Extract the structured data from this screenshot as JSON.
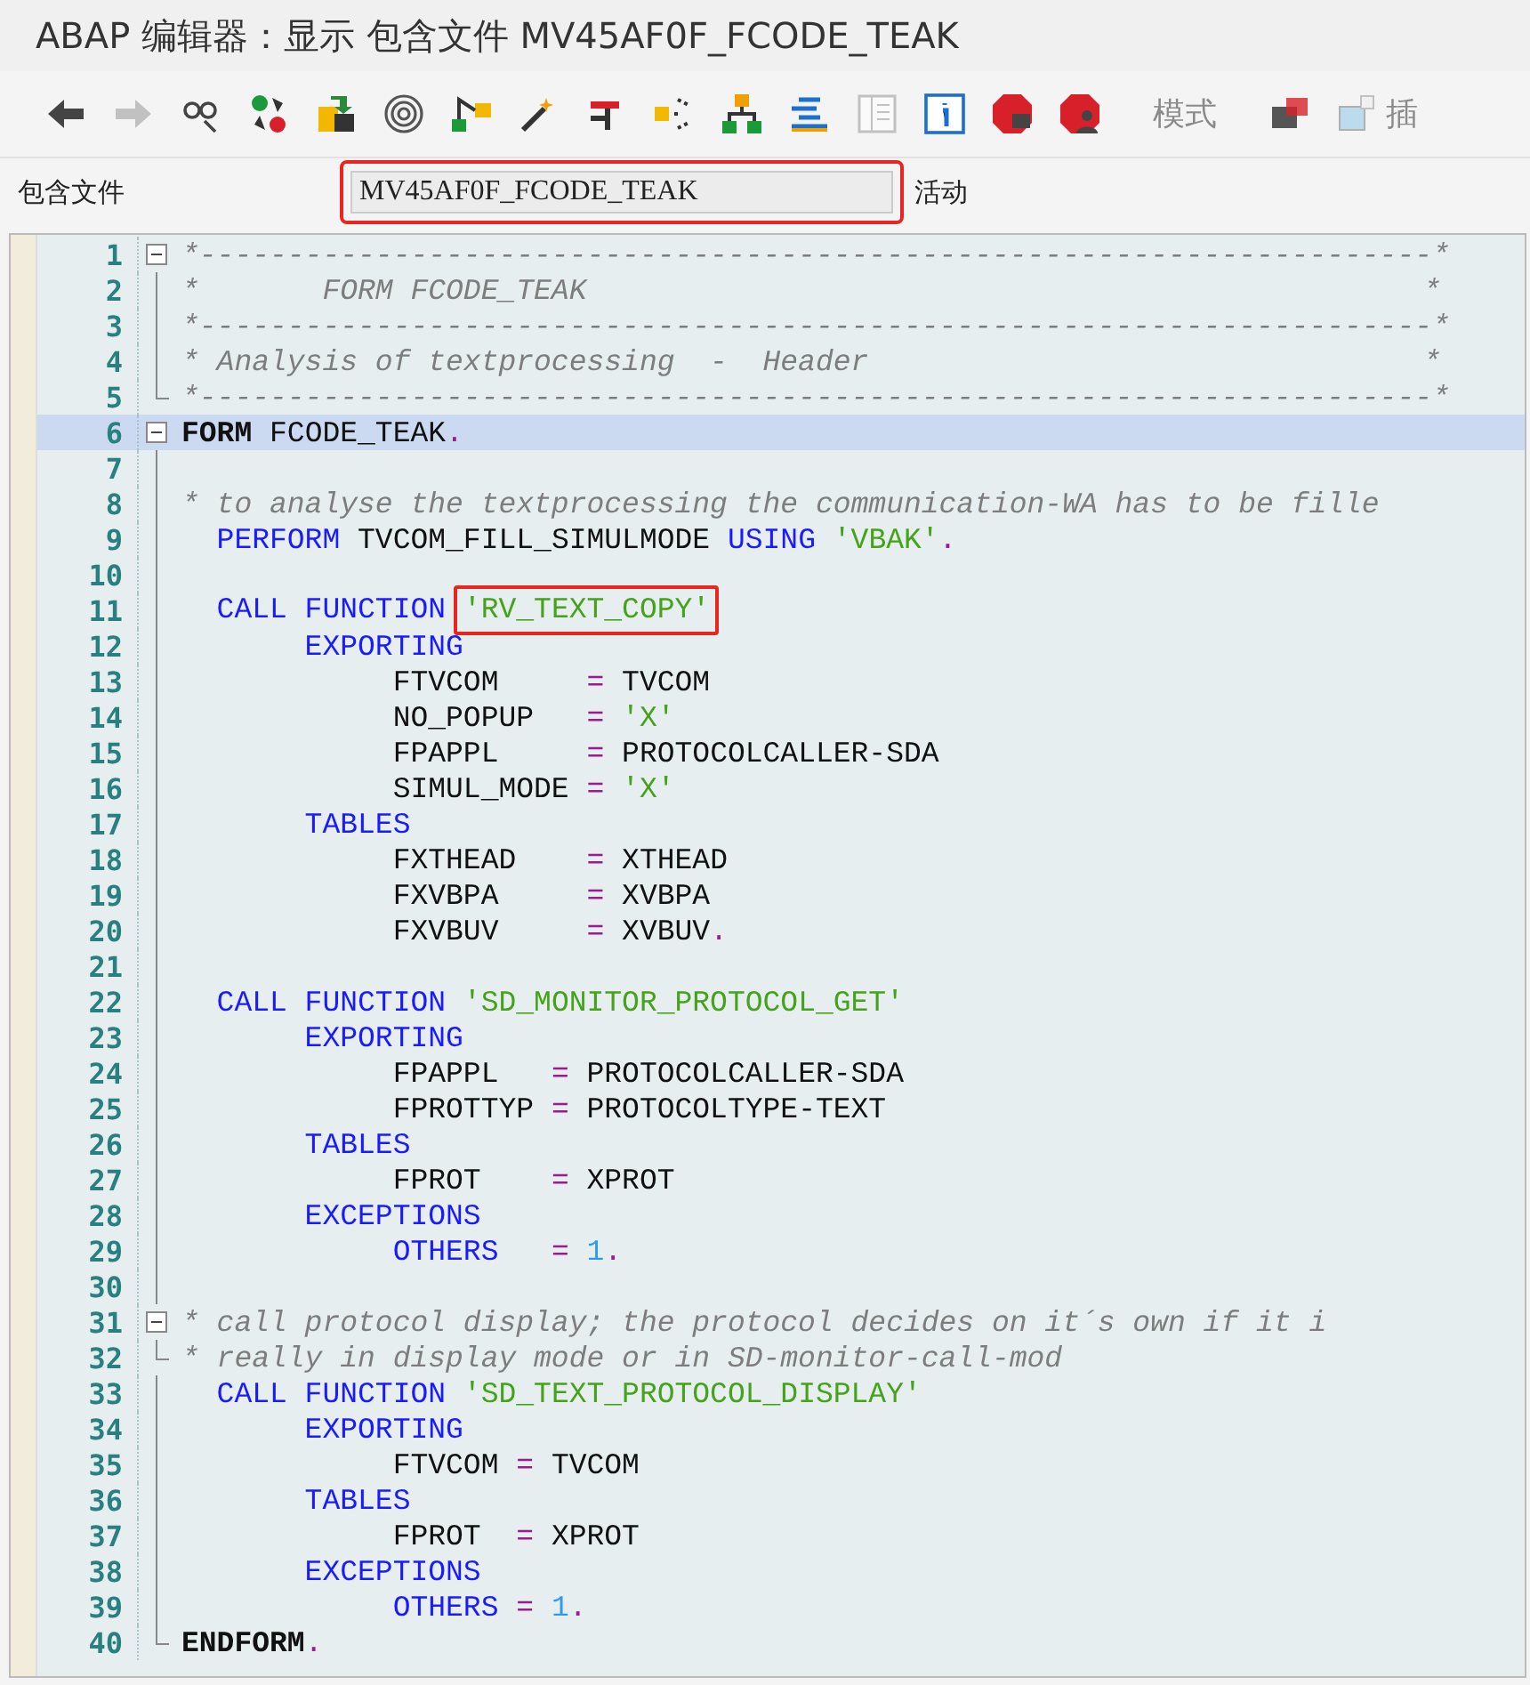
{
  "window": {
    "title": "ABAP 编辑器：显示 包含文件 MV45AF0F_FCODE_TEAK"
  },
  "toolbar": [
    {
      "kind": "back",
      "disabled": false
    },
    {
      "kind": "forward",
      "disabled": true
    },
    {
      "kind": "glasses",
      "disabled": false
    },
    {
      "kind": "cycle",
      "disabled": false
    },
    {
      "kind": "transport",
      "disabled": false
    },
    {
      "kind": "spiral",
      "disabled": false
    },
    {
      "kind": "hierarchy",
      "disabled": false
    },
    {
      "kind": "wand",
      "disabled": false
    },
    {
      "kind": "stamp",
      "disabled": false
    },
    {
      "kind": "branch",
      "disabled": false
    },
    {
      "kind": "tree",
      "disabled": false
    },
    {
      "kind": "lines",
      "disabled": false
    },
    {
      "kind": "page",
      "disabled": true
    },
    {
      "kind": "info",
      "disabled": false
    },
    {
      "kind": "stop",
      "disabled": false
    },
    {
      "kind": "stop-user",
      "disabled": false
    },
    {
      "kind": "text",
      "label": "模式",
      "disabled": true
    },
    {
      "kind": "blocks",
      "disabled": false
    },
    {
      "kind": "insert",
      "label": "插",
      "disabled": true
    }
  ],
  "include_field": {
    "label": "包含文件",
    "value": "MV45AF0F_FCODE_TEAK",
    "highlighted": true,
    "status": "活动"
  },
  "editor": {
    "lines": [
      {
        "number": "1",
        "current": false,
        "kind": "open",
        "end_mark": "*",
        "tokens": [
          {
            "kind": "cmt",
            "t": "*----------------------------------------------------------------------"
          }
        ]
      },
      {
        "number": "2",
        "current": false,
        "kind": "line",
        "end_mark": "*",
        "tokens": [
          {
            "kind": "cmt",
            "t": "*       FORM FCODE_TEAK"
          }
        ]
      },
      {
        "number": "3",
        "current": false,
        "kind": "line",
        "end_mark": "*",
        "tokens": [
          {
            "kind": "cmt",
            "t": "*----------------------------------------------------------------------"
          }
        ]
      },
      {
        "number": "4",
        "current": false,
        "kind": "line",
        "end_mark": "*",
        "tokens": [
          {
            "kind": "cmt",
            "t": "* Analysis of textprocessing  -  Header"
          }
        ]
      },
      {
        "number": "5",
        "current": false,
        "kind": "end",
        "end_mark": "*",
        "tokens": [
          {
            "kind": "cmt",
            "t": "*----------------------------------------------------------------------"
          }
        ]
      },
      {
        "number": "6",
        "current": true,
        "kind": "open",
        "tokens": [
          {
            "kind": "bold",
            "t": "FORM"
          },
          {
            "kind": "id",
            "t": " FCODE_TEAK"
          },
          {
            "kind": "op",
            "t": "."
          }
        ]
      },
      {
        "number": "7",
        "current": false,
        "kind": "line"
      },
      {
        "number": "8",
        "current": false,
        "kind": "line",
        "tokens": [
          {
            "kind": "cmt",
            "t": "* to analyse the textprocessing the communication-WA has to be fille"
          }
        ]
      },
      {
        "number": "9",
        "current": false,
        "kind": "line",
        "tokens": [
          {
            "kind": "kw",
            "t": "  PERFORM"
          },
          {
            "kind": "id",
            "t": " TVCOM_FILL_SIMULMODE "
          },
          {
            "kind": "kw",
            "t": "USING"
          },
          {
            "kind": "str",
            "t": " 'VBAK'"
          },
          {
            "kind": "op",
            "t": "."
          }
        ]
      },
      {
        "number": "10",
        "current": false,
        "kind": "line"
      },
      {
        "number": "11",
        "current": false,
        "kind": "line",
        "tokens": [
          {
            "kind": "kw",
            "t": "  CALL FUNCTION "
          },
          {
            "kind": "str",
            "t": "'RV_TEXT_COPY'",
            "highlighted": true
          }
        ]
      },
      {
        "number": "12",
        "current": false,
        "kind": "line",
        "tokens": [
          {
            "kind": "kw",
            "t": "       EXPORTING"
          }
        ]
      },
      {
        "number": "13",
        "current": false,
        "kind": "line",
        "tokens": [
          {
            "kind": "id",
            "t": "            FTVCOM     "
          },
          {
            "kind": "op",
            "t": "="
          },
          {
            "kind": "id",
            "t": " TVCOM"
          }
        ]
      },
      {
        "number": "14",
        "current": false,
        "kind": "line",
        "tokens": [
          {
            "kind": "id",
            "t": "            NO_POPUP   "
          },
          {
            "kind": "op",
            "t": "="
          },
          {
            "kind": "str",
            "t": " 'X'"
          }
        ]
      },
      {
        "number": "15",
        "current": false,
        "kind": "line",
        "tokens": [
          {
            "kind": "id",
            "t": "            FPAPPL     "
          },
          {
            "kind": "op",
            "t": "="
          },
          {
            "kind": "id",
            "t": " PROTOCOLCALLER-SDA"
          }
        ]
      },
      {
        "number": "16",
        "current": false,
        "kind": "line",
        "tokens": [
          {
            "kind": "id",
            "t": "            SIMUL_MODE "
          },
          {
            "kind": "op",
            "t": "="
          },
          {
            "kind": "str",
            "t": " 'X'"
          }
        ]
      },
      {
        "number": "17",
        "current": false,
        "kind": "line",
        "tokens": [
          {
            "kind": "kw",
            "t": "       TABLES"
          }
        ]
      },
      {
        "number": "18",
        "current": false,
        "kind": "line",
        "tokens": [
          {
            "kind": "id",
            "t": "            FXTHEAD    "
          },
          {
            "kind": "op",
            "t": "="
          },
          {
            "kind": "id",
            "t": " XTHEAD"
          }
        ]
      },
      {
        "number": "19",
        "current": false,
        "kind": "line",
        "tokens": [
          {
            "kind": "id",
            "t": "            FXVBPA     "
          },
          {
            "kind": "op",
            "t": "="
          },
          {
            "kind": "id",
            "t": " XVBPA"
          }
        ]
      },
      {
        "number": "20",
        "current": false,
        "kind": "line",
        "tokens": [
          {
            "kind": "id",
            "t": "            FXVBUV     "
          },
          {
            "kind": "op",
            "t": "="
          },
          {
            "kind": "id",
            "t": " XVBUV"
          },
          {
            "kind": "op",
            "t": "."
          }
        ]
      },
      {
        "number": "21",
        "current": false,
        "kind": "line"
      },
      {
        "number": "22",
        "current": false,
        "kind": "line",
        "tokens": [
          {
            "kind": "kw",
            "t": "  CALL FUNCTION "
          },
          {
            "kind": "str",
            "t": "'SD_MONITOR_PROTOCOL_GET'"
          }
        ]
      },
      {
        "number": "23",
        "current": false,
        "kind": "line",
        "tokens": [
          {
            "kind": "kw",
            "t": "       EXPORTING"
          }
        ]
      },
      {
        "number": "24",
        "current": false,
        "kind": "line",
        "tokens": [
          {
            "kind": "id",
            "t": "            FPAPPL   "
          },
          {
            "kind": "op",
            "t": "="
          },
          {
            "kind": "id",
            "t": " PROTOCOLCALLER-SDA"
          }
        ]
      },
      {
        "number": "25",
        "current": false,
        "kind": "line",
        "tokens": [
          {
            "kind": "id",
            "t": "            FPROTTYP "
          },
          {
            "kind": "op",
            "t": "="
          },
          {
            "kind": "id",
            "t": " PROTOCOLTYPE-TEXT"
          }
        ]
      },
      {
        "number": "26",
        "current": false,
        "kind": "line",
        "tokens": [
          {
            "kind": "kw",
            "t": "       TABLES"
          }
        ]
      },
      {
        "number": "27",
        "current": false,
        "kind": "line",
        "tokens": [
          {
            "kind": "id",
            "t": "            FPROT    "
          },
          {
            "kind": "op",
            "t": "="
          },
          {
            "kind": "id",
            "t": " XPROT"
          }
        ]
      },
      {
        "number": "28",
        "current": false,
        "kind": "line",
        "tokens": [
          {
            "kind": "kw",
            "t": "       EXCEPTIONS"
          }
        ]
      },
      {
        "number": "29",
        "current": false,
        "kind": "line",
        "tokens": [
          {
            "kind": "kw",
            "t": "            OTHERS   "
          },
          {
            "kind": "op",
            "t": "="
          },
          {
            "kind": "num",
            "t": " 1"
          },
          {
            "kind": "op",
            "t": "."
          }
        ]
      },
      {
        "number": "30",
        "current": false,
        "kind": "line"
      },
      {
        "number": "31",
        "current": false,
        "kind": "open",
        "tokens": [
          {
            "kind": "cmt",
            "t": "* call protocol display; the protocol decides on it´s own if it i"
          }
        ]
      },
      {
        "number": "32",
        "current": false,
        "kind": "end",
        "tokens": [
          {
            "kind": "cmt",
            "t": "* really in display mode or in SD-monitor-call-mod"
          }
        ]
      },
      {
        "number": "33",
        "current": false,
        "kind": "line",
        "tokens": [
          {
            "kind": "kw",
            "t": "  CALL FUNCTION "
          },
          {
            "kind": "str",
            "t": "'SD_TEXT_PROTOCOL_DISPLAY'"
          }
        ]
      },
      {
        "number": "34",
        "current": false,
        "kind": "line",
        "tokens": [
          {
            "kind": "kw",
            "t": "       EXPORTING"
          }
        ]
      },
      {
        "number": "35",
        "current": false,
        "kind": "line",
        "tokens": [
          {
            "kind": "id",
            "t": "            FTVCOM "
          },
          {
            "kind": "op",
            "t": "="
          },
          {
            "kind": "id",
            "t": " TVCOM"
          }
        ]
      },
      {
        "number": "36",
        "current": false,
        "kind": "line",
        "tokens": [
          {
            "kind": "kw",
            "t": "       TABLES"
          }
        ]
      },
      {
        "number": "37",
        "current": false,
        "kind": "line",
        "tokens": [
          {
            "kind": "id",
            "t": "            FPROT  "
          },
          {
            "kind": "op",
            "t": "="
          },
          {
            "kind": "id",
            "t": " XPROT"
          }
        ]
      },
      {
        "number": "38",
        "current": false,
        "kind": "line",
        "tokens": [
          {
            "kind": "kw",
            "t": "       EXCEPTIONS"
          }
        ]
      },
      {
        "number": "39",
        "current": false,
        "kind": "line",
        "tokens": [
          {
            "kind": "kw",
            "t": "            OTHERS "
          },
          {
            "kind": "op",
            "t": "="
          },
          {
            "kind": "num",
            "t": " 1"
          },
          {
            "kind": "op",
            "t": "."
          }
        ]
      },
      {
        "number": "40",
        "current": false,
        "kind": "end",
        "tokens": [
          {
            "kind": "bold",
            "t": "ENDFORM"
          },
          {
            "kind": "op",
            "t": "."
          }
        ]
      }
    ]
  }
}
